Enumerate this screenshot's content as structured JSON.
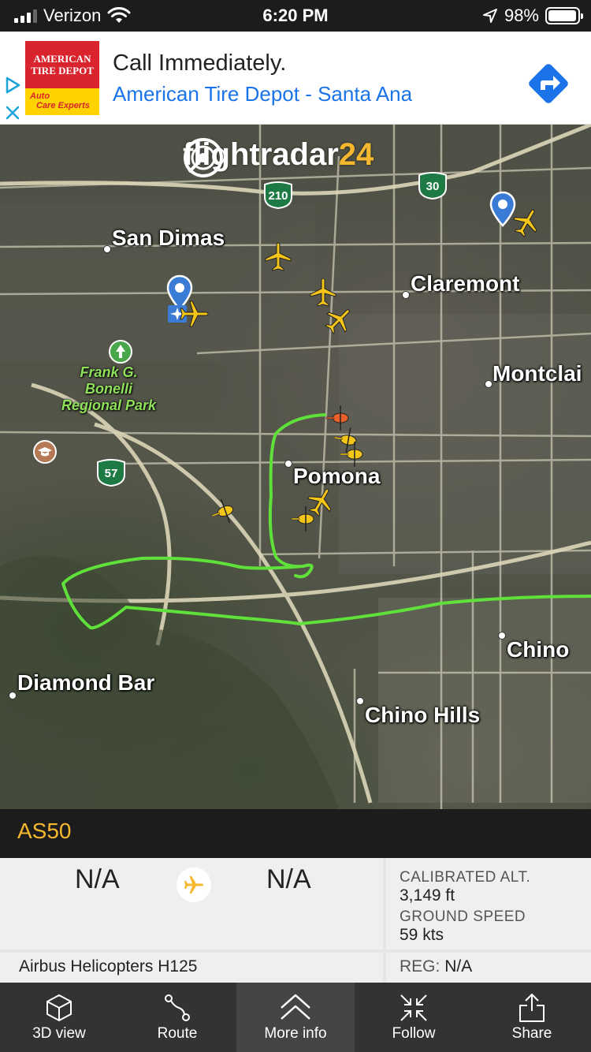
{
  "status_bar": {
    "carrier": "Verizon",
    "time": "6:20 PM",
    "battery": "98%",
    "battery_level": 0.98
  },
  "ad": {
    "logo_line1": "AMERICAN",
    "logo_line2": "TIRE DEPOT",
    "logo_sub1": "Auto",
    "logo_sub2": "Care Experts",
    "headline": "Call Immediately.",
    "subline": "American Tire Depot - Santa Ana",
    "icons": [
      "adchoices-icon",
      "close-icon",
      "directions-icon"
    ]
  },
  "map": {
    "logo_text": "flightradar",
    "logo_num": "24",
    "cities": [
      "San Dimas",
      "Claremont",
      "Montclai",
      "Pomona",
      "Diamond Bar",
      "Chino",
      "Chino Hills"
    ],
    "park": [
      "Frank G.",
      "Bonelli",
      "Regional Park"
    ],
    "shields": [
      "210",
      "30",
      "57"
    ],
    "colors": {
      "track": "#5fe03a",
      "selected_plane": "#e8602a",
      "plane": "#f5c518"
    }
  },
  "flight": {
    "callsign": "AS50",
    "from": "N/A",
    "to": "N/A",
    "calibrated_alt_label": "CALIBRATED ALT.",
    "calibrated_alt": "3,149 ft",
    "ground_speed_label": "GROUND SPEED",
    "ground_speed": "59 kts",
    "aircraft": "Airbus Helicopters H125",
    "reg_label": "REG:",
    "reg": "N/A"
  },
  "nav": {
    "items": [
      {
        "label": "3D view",
        "icon": "cube-icon"
      },
      {
        "label": "Route",
        "icon": "route-icon"
      },
      {
        "label": "More info",
        "icon": "chevrons-up-icon",
        "active": true
      },
      {
        "label": "Follow",
        "icon": "follow-icon"
      },
      {
        "label": "Share",
        "icon": "share-icon"
      }
    ]
  }
}
